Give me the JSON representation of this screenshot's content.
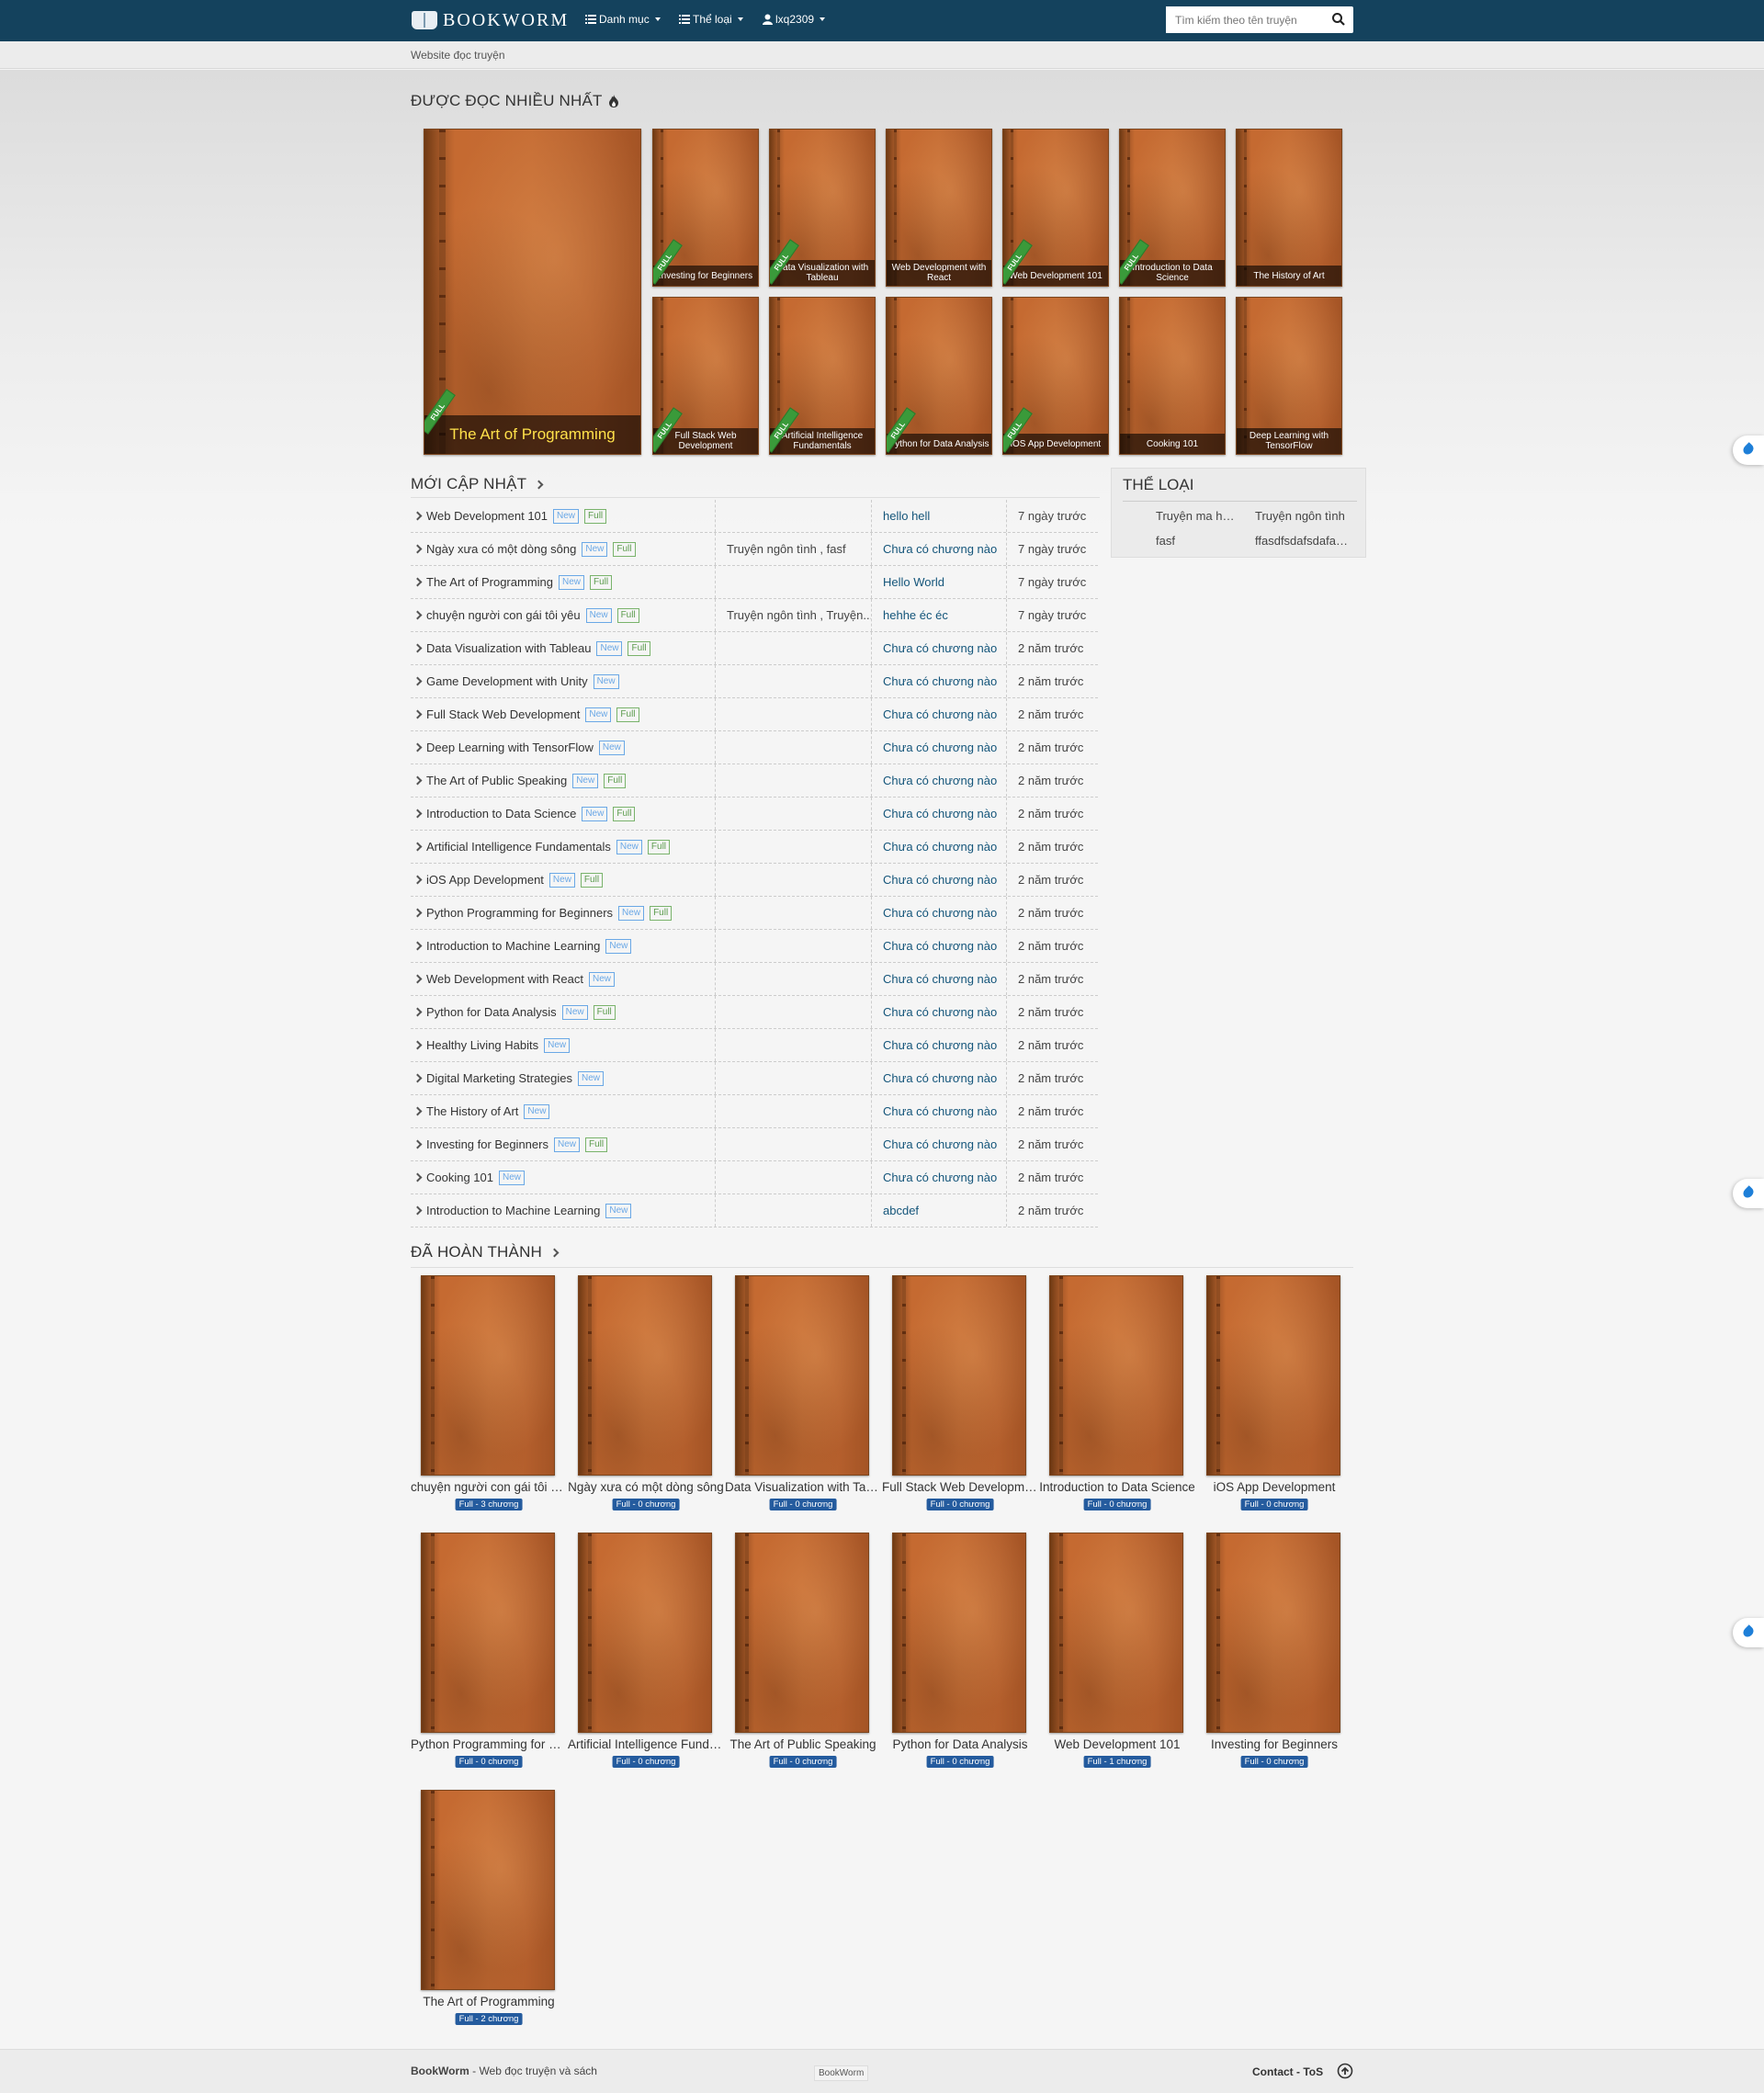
{
  "nav": {
    "brand": "BOOKWORM",
    "menu_category": "Danh mục",
    "menu_genre": "Thể loại",
    "menu_user": "lxq2309",
    "search_placeholder": "Tìm kiếm theo tên truyện"
  },
  "subbar": {
    "text": "Website đọc truyện"
  },
  "hot": {
    "title": "ĐƯỢC ĐỌC NHIỀU NHẤT",
    "featured": {
      "title": "The Art of Programming",
      "ribbon": "FULL"
    },
    "items": [
      {
        "title": "Investing for Beginners",
        "full": true
      },
      {
        "title": "Data Visualization with Tableau",
        "full": true
      },
      {
        "title": "Web Development with React",
        "full": false
      },
      {
        "title": "Web Development 101",
        "full": true
      },
      {
        "title": "Introduction to Data Science",
        "full": true
      },
      {
        "title": "The History of Art",
        "full": false
      },
      {
        "title": "Full Stack Web Development",
        "full": true
      },
      {
        "title": "Artificial Intelligence Fundamentals",
        "full": true
      },
      {
        "title": "Python for Data Analysis",
        "full": true
      },
      {
        "title": "iOS App Development",
        "full": true
      },
      {
        "title": "Cooking 101",
        "full": false
      },
      {
        "title": "Deep Learning with TensorFlow",
        "full": false
      }
    ]
  },
  "latest": {
    "title": "MỚI CẬP NHẬT",
    "tag_new": "New",
    "tag_full": "Full",
    "rows": [
      {
        "title": "Web Development 101",
        "new": true,
        "full": true,
        "genres": "",
        "chapter": "hello hell",
        "time": "7 ngày trước"
      },
      {
        "title": "Ngày xưa có một dòng sông",
        "new": true,
        "full": true,
        "genres": "Truyện ngôn tình , fasf",
        "chapter": "Chưa có chương nào",
        "time": "7 ngày trước"
      },
      {
        "title": "The Art of Programming",
        "new": true,
        "full": true,
        "genres": "",
        "chapter": "Hello World",
        "time": "7 ngày trước"
      },
      {
        "title": "chuyện người con gái tôi yêu",
        "new": true,
        "full": true,
        "genres": "Truyện ngôn tình , Truyện...",
        "chapter": "hehhe éc éc",
        "time": "7 ngày trước"
      },
      {
        "title": "Data Visualization with Tableau",
        "new": true,
        "full": true,
        "genres": "",
        "chapter": "Chưa có chương nào",
        "time": "2 năm trước"
      },
      {
        "title": "Game Development with Unity",
        "new": true,
        "full": false,
        "genres": "",
        "chapter": "Chưa có chương nào",
        "time": "2 năm trước"
      },
      {
        "title": "Full Stack Web Development",
        "new": true,
        "full": true,
        "genres": "",
        "chapter": "Chưa có chương nào",
        "time": "2 năm trước"
      },
      {
        "title": "Deep Learning with TensorFlow",
        "new": true,
        "full": false,
        "genres": "",
        "chapter": "Chưa có chương nào",
        "time": "2 năm trước"
      },
      {
        "title": "The Art of Public Speaking",
        "new": true,
        "full": true,
        "genres": "",
        "chapter": "Chưa có chương nào",
        "time": "2 năm trước"
      },
      {
        "title": "Introduction to Data Science",
        "new": true,
        "full": true,
        "genres": "",
        "chapter": "Chưa có chương nào",
        "time": "2 năm trước"
      },
      {
        "title": "Artificial Intelligence Fundamentals",
        "new": true,
        "full": true,
        "genres": "",
        "chapter": "Chưa có chương nào",
        "time": "2 năm trước"
      },
      {
        "title": "iOS App Development",
        "new": true,
        "full": true,
        "genres": "",
        "chapter": "Chưa có chương nào",
        "time": "2 năm trước"
      },
      {
        "title": "Python Programming for Beginners",
        "new": true,
        "full": true,
        "genres": "",
        "chapter": "Chưa có chương nào",
        "time": "2 năm trước"
      },
      {
        "title": "Introduction to Machine Learning",
        "new": true,
        "full": false,
        "genres": "",
        "chapter": "Chưa có chương nào",
        "time": "2 năm trước"
      },
      {
        "title": "Web Development with React",
        "new": true,
        "full": false,
        "genres": "",
        "chapter": "Chưa có chương nào",
        "time": "2 năm trước"
      },
      {
        "title": "Python for Data Analysis",
        "new": true,
        "full": true,
        "genres": "",
        "chapter": "Chưa có chương nào",
        "time": "2 năm trước"
      },
      {
        "title": "Healthy Living Habits",
        "new": true,
        "full": false,
        "genres": "",
        "chapter": "Chưa có chương nào",
        "time": "2 năm trước"
      },
      {
        "title": "Digital Marketing Strategies",
        "new": true,
        "full": false,
        "genres": "",
        "chapter": "Chưa có chương nào",
        "time": "2 năm trước"
      },
      {
        "title": "The History of Art",
        "new": true,
        "full": false,
        "genres": "",
        "chapter": "Chưa có chương nào",
        "time": "2 năm trước"
      },
      {
        "title": "Investing for Beginners",
        "new": true,
        "full": true,
        "genres": "",
        "chapter": "Chưa có chương nào",
        "time": "2 năm trước"
      },
      {
        "title": "Cooking 101",
        "new": true,
        "full": false,
        "genres": "",
        "chapter": "Chưa có chương nào",
        "time": "2 năm trước"
      },
      {
        "title": "Introduction to Machine Learning",
        "new": true,
        "full": false,
        "genres": "",
        "chapter": "abcdef",
        "time": "2 năm trước"
      }
    ]
  },
  "genres": {
    "title": "THỂ LOẠI",
    "items": [
      "Truyện ma hành...",
      "Truyện ngôn tình",
      "fasf",
      "ffasdfsdafsdafadsf..."
    ]
  },
  "completed": {
    "title": "ĐÃ HOÀN THÀNH",
    "items": [
      {
        "title": "chuyện người con gái tôi yêu",
        "badge": "Full - 3 chương"
      },
      {
        "title": "Ngày xưa có một dòng sông",
        "badge": "Full - 0 chương"
      },
      {
        "title": "Data Visualization with Tableau",
        "badge": "Full - 0 chương"
      },
      {
        "title": "Full Stack Web Development",
        "badge": "Full - 0 chương"
      },
      {
        "title": "Introduction to Data Science",
        "badge": "Full - 0 chương"
      },
      {
        "title": "iOS App Development",
        "badge": "Full - 0 chương"
      },
      {
        "title": "Python Programming for Beginners",
        "badge": "Full - 0 chương"
      },
      {
        "title": "Artificial Intelligence Fundamentals",
        "badge": "Full - 0 chương"
      },
      {
        "title": "The Art of Public Speaking",
        "badge": "Full - 0 chương"
      },
      {
        "title": "Python for Data Analysis",
        "badge": "Full - 0 chương"
      },
      {
        "title": "Web Development 101",
        "badge": "Full - 1 chương"
      },
      {
        "title": "Investing for Beginners",
        "badge": "Full - 0 chương"
      },
      {
        "title": "The Art of Programming",
        "badge": "Full - 2 chương"
      }
    ]
  },
  "footer": {
    "brand": "BookWorm",
    "tagline": " - Web đọc truyện và sách",
    "center": "BookWorm",
    "contact": "Contact",
    "sep": " - ",
    "tos": "ToS"
  },
  "colors": {
    "navbar": "#14425d",
    "badge": "#245b9e",
    "link": "#14557a"
  }
}
